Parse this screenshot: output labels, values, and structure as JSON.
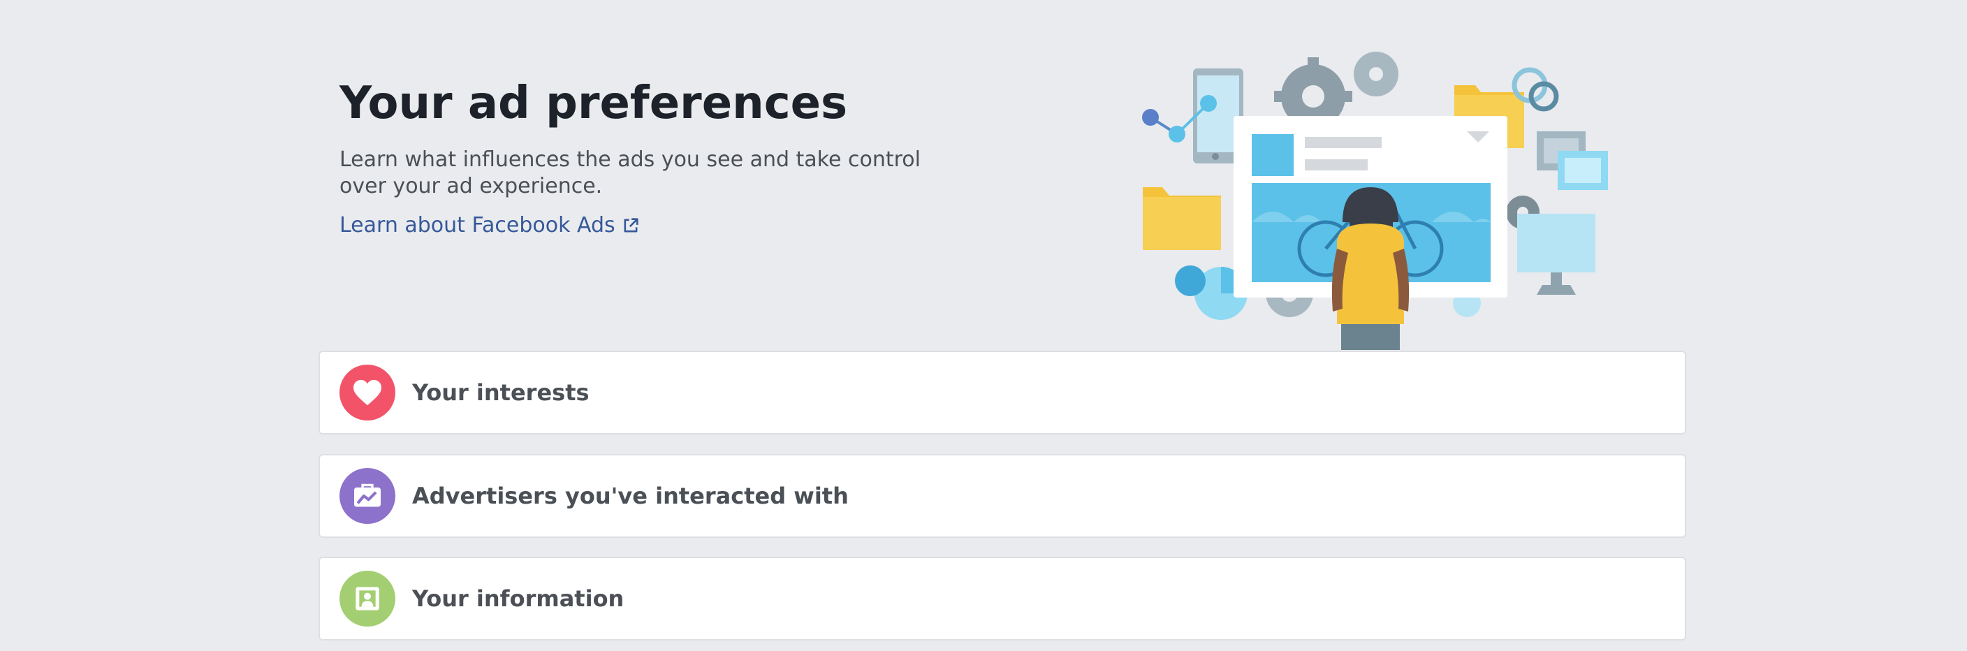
{
  "header": {
    "title": "Your ad preferences",
    "subtitle": "Learn what influences the ads you see and take control over your ad experience.",
    "link_label": "Learn about Facebook Ads",
    "link_icon": "external-link-icon"
  },
  "sections": [
    {
      "label": "Your interests",
      "icon": "heart-icon",
      "color": "#f35369"
    },
    {
      "label": "Advertisers you've interacted with",
      "icon": "briefcase-icon",
      "color": "#8c72cb"
    },
    {
      "label": "Your information",
      "icon": "profile-card-icon",
      "color": "#a3ce71"
    }
  ],
  "colors": {
    "background": "#e9ebee",
    "link": "#365899",
    "title": "#1d2129",
    "text": "#4b4f56"
  }
}
